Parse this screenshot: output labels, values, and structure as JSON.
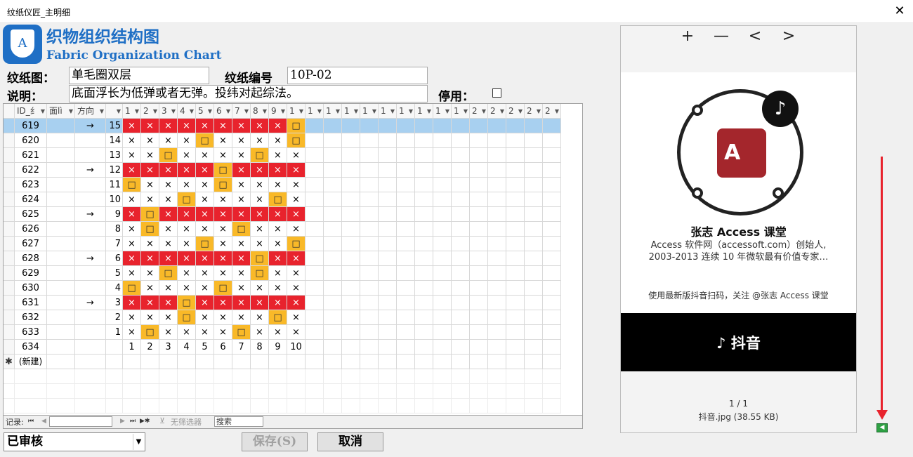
{
  "window": {
    "title": "纹纸仪匠_主明细",
    "close_glyph": "✕"
  },
  "header": {
    "title_cn": "织物组织结构图",
    "title_en": "Fabric Organization Chart",
    "logo_glyph": "A"
  },
  "form": {
    "pattern_label": "纹纸图：",
    "pattern_value": "单毛圈双层",
    "code_label": "纹纸编号",
    "code_value": "10P-02",
    "desc_label": "说明：",
    "desc_value": "底面浮长为低弹或者无弹。投纬对起综法。",
    "disable_label": "停用：",
    "disable_checked": false
  },
  "grid": {
    "columns": [
      "ID_纟",
      "面lì",
      "方向",
      "",
      "1",
      "2",
      "3",
      "4",
      "5",
      "6",
      "7",
      "8",
      "9",
      "1",
      "1",
      "1",
      "1",
      "1",
      "1",
      "1",
      "1",
      "1",
      "1",
      "2",
      "2",
      "2",
      "2",
      "2"
    ],
    "rows": [
      {
        "id": "619",
        "dir": "→",
        "n": "15",
        "cells": [
          "R",
          "R",
          "R",
          "R",
          "R",
          "R",
          "R",
          "R",
          "R",
          "O"
        ]
      },
      {
        "id": "620",
        "dir": "",
        "n": "14",
        "cells": [
          "x",
          "x",
          "x",
          "x",
          "O",
          "x",
          "x",
          "x",
          "x",
          "O"
        ]
      },
      {
        "id": "621",
        "dir": "",
        "n": "13",
        "cells": [
          "x",
          "x",
          "O",
          "x",
          "x",
          "x",
          "x",
          "O",
          "x",
          "x"
        ]
      },
      {
        "id": "622",
        "dir": "→",
        "n": "12",
        "cells": [
          "R",
          "R",
          "R",
          "R",
          "R",
          "O",
          "R",
          "R",
          "R",
          "R"
        ]
      },
      {
        "id": "623",
        "dir": "",
        "n": "11",
        "cells": [
          "O",
          "x",
          "x",
          "x",
          "x",
          "O",
          "x",
          "x",
          "x",
          "x"
        ]
      },
      {
        "id": "624",
        "dir": "",
        "n": "10",
        "cells": [
          "x",
          "x",
          "x",
          "O",
          "x",
          "x",
          "x",
          "x",
          "O",
          "x"
        ]
      },
      {
        "id": "625",
        "dir": "→",
        "n": "9",
        "cells": [
          "R",
          "O",
          "R",
          "R",
          "R",
          "R",
          "R",
          "R",
          "R",
          "R"
        ]
      },
      {
        "id": "626",
        "dir": "",
        "n": "8",
        "cells": [
          "x",
          "O",
          "x",
          "x",
          "x",
          "x",
          "O",
          "x",
          "x",
          "x"
        ]
      },
      {
        "id": "627",
        "dir": "",
        "n": "7",
        "cells": [
          "x",
          "x",
          "x",
          "x",
          "O",
          "x",
          "x",
          "x",
          "x",
          "O"
        ]
      },
      {
        "id": "628",
        "dir": "→",
        "n": "6",
        "cells": [
          "R",
          "R",
          "R",
          "R",
          "R",
          "R",
          "R",
          "O",
          "R",
          "R"
        ]
      },
      {
        "id": "629",
        "dir": "",
        "n": "5",
        "cells": [
          "x",
          "x",
          "O",
          "x",
          "x",
          "x",
          "x",
          "O",
          "x",
          "x"
        ]
      },
      {
        "id": "630",
        "dir": "",
        "n": "4",
        "cells": [
          "O",
          "x",
          "x",
          "x",
          "x",
          "O",
          "x",
          "x",
          "x",
          "x"
        ]
      },
      {
        "id": "631",
        "dir": "→",
        "n": "3",
        "cells": [
          "R",
          "R",
          "R",
          "O",
          "R",
          "R",
          "R",
          "R",
          "R",
          "R"
        ]
      },
      {
        "id": "632",
        "dir": "",
        "n": "2",
        "cells": [
          "x",
          "x",
          "x",
          "O",
          "x",
          "x",
          "x",
          "x",
          "O",
          "x"
        ]
      },
      {
        "id": "633",
        "dir": "",
        "n": "1",
        "cells": [
          "x",
          "O",
          "x",
          "x",
          "x",
          "x",
          "O",
          "x",
          "x",
          "x"
        ]
      },
      {
        "id": "634",
        "dir": "",
        "n": "",
        "cells": [
          "1",
          "2",
          "3",
          "4",
          "5",
          "6",
          "7",
          "8",
          "9",
          "10"
        ]
      }
    ],
    "new_row_label": "(新建)",
    "new_row_marker": "✱",
    "cell_x": "×",
    "cell_o": "□"
  },
  "navbar": {
    "record_label": "记录:",
    "first": "⏮",
    "prev": "◀",
    "next": "▶",
    "last": "⏭",
    "new": "▶✱",
    "filter_label": "无筛选器",
    "search_label": "搜索"
  },
  "footer": {
    "status_value": "已审核",
    "save_label": "保存(S)",
    "cancel_label": "取消"
  },
  "viewer": {
    "zoom_in": "+",
    "zoom_out": "—",
    "prev": "<",
    "next": ">",
    "poster_title": "张志 Access 课堂",
    "poster_desc_1": "Access 软件网（accessoft.com）创始人,",
    "poster_desc_2": "2003-2013 连续 10 年微软最有价值专家…",
    "poster_scan": "使用最新版抖音扫码，关注 @张志 Access 课堂",
    "tiktok_brand": "抖音",
    "tiktok_glyph": "♪",
    "access_glyph": "A",
    "page_count": "1 / 1",
    "file_info": "抖音.jpg (38.55 KB)"
  },
  "colors": {
    "accent": "#1f6fc5",
    "red_cell": "#e8232d",
    "orange_cell": "#f9b928",
    "selected_row": "#a8d0f0"
  }
}
